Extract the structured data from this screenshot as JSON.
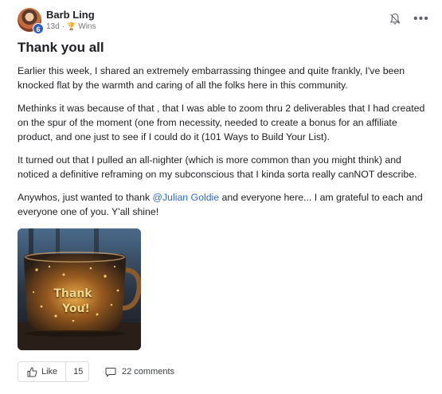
{
  "author": {
    "name": "Barb Ling",
    "level": "6"
  },
  "meta": {
    "time": "13d",
    "separator": "·",
    "category": "Wins",
    "category_icon": "trophy-icon"
  },
  "post": {
    "title": "Thank you all",
    "paragraphs": [
      "Earlier this week, I shared an extremely embarrassing thingee and quite frankly, I've been knocked flat by the warmth and caring of all the folks here in this community.",
      "Methinks it was because of that , that I was able to zoom thru 2 deliverables that I had created on the spur of the moment (one from necessity, needed to create a bonus for an affiliate product, and one just to see if I could do it (101 Ways to Build Your List).",
      "It turned out that I pulled an all-nighter (which is more common than you might think) and noticed a definitive reframing on my subconscious that I kinda sorta really canNOT describe."
    ],
    "last_paragraph": {
      "before": "Anywhos, just wanted to thank ",
      "mention": "@Julian Goldie",
      "after": " and everyone here... I am grateful to each and everyone one of you. Y'all shine!"
    },
    "image_text": {
      "line1": "Thank",
      "line2": "You!"
    }
  },
  "actions": {
    "like_label": "Like",
    "like_count": "15",
    "comments_label": "22 comments"
  },
  "colors": {
    "accent": "#2e6ad1",
    "badge": "#2e5cc8",
    "trophy": "#b98a1d"
  }
}
